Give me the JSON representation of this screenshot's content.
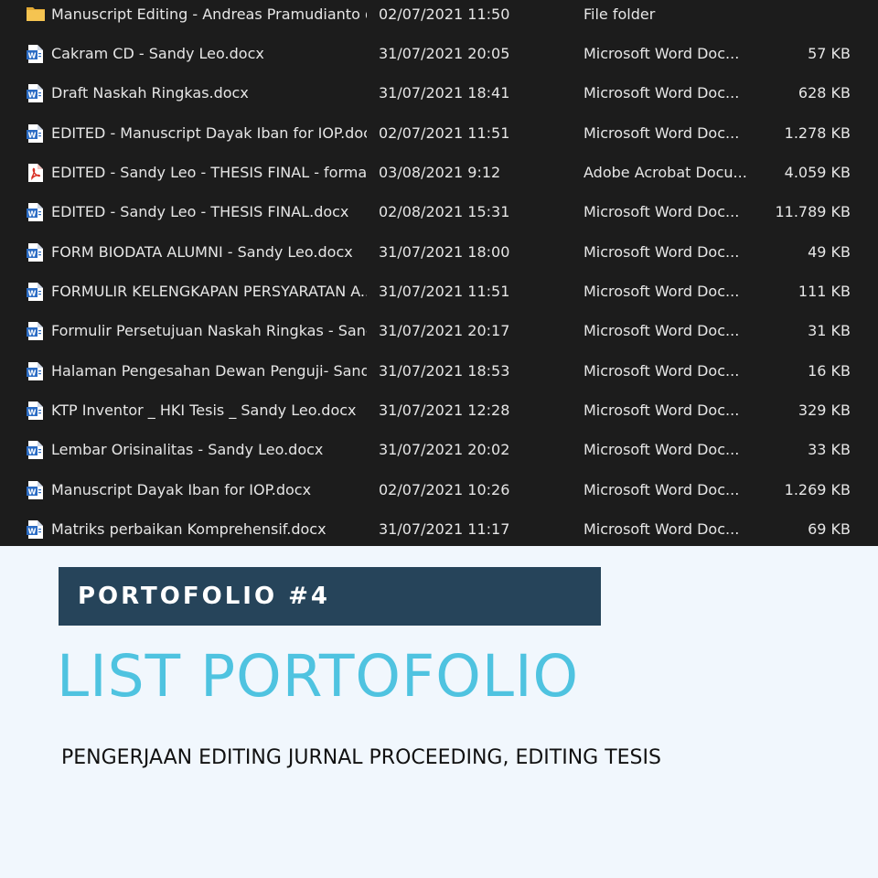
{
  "file_list": [
    {
      "icon": "folder-icon",
      "name": "Manuscript Editing - Andreas Pramudianto d...",
      "date": "02/07/2021 11:50",
      "type": "File folder",
      "size": ""
    },
    {
      "icon": "word-doc-icon",
      "name": "Cakram CD - Sandy Leo.docx",
      "date": "31/07/2021 20:05",
      "type": "Microsoft Word Doc...",
      "size": "57 KB"
    },
    {
      "icon": "word-doc-icon",
      "name": "Draft Naskah Ringkas.docx",
      "date": "31/07/2021 18:41",
      "type": "Microsoft Word Doc...",
      "size": "628 KB"
    },
    {
      "icon": "word-doc-icon",
      "name": "EDITED - Manuscript Dayak Iban for IOP.docx",
      "date": "02/07/2021 11:51",
      "type": "Microsoft Word Doc...",
      "size": "1.278 KB"
    },
    {
      "icon": "pdf-icon",
      "name": "EDITED - Sandy Leo - THESIS FINAL - format...",
      "date": "03/08/2021 9:12",
      "type": "Adobe Acrobat Docu...",
      "size": "4.059 KB"
    },
    {
      "icon": "word-doc-icon",
      "name": "EDITED - Sandy Leo - THESIS FINAL.docx",
      "date": "02/08/2021 15:31",
      "type": "Microsoft Word Doc...",
      "size": "11.789 KB"
    },
    {
      "icon": "word-doc-icon",
      "name": "FORM BIODATA ALUMNI - Sandy Leo.docx",
      "date": "31/07/2021 18:00",
      "type": "Microsoft Word Doc...",
      "size": "49 KB"
    },
    {
      "icon": "word-doc-icon",
      "name": "FORMULIR KELENGKAPAN PERSYARATAN A...",
      "date": "31/07/2021 11:51",
      "type": "Microsoft Word Doc...",
      "size": "111 KB"
    },
    {
      "icon": "word-doc-icon",
      "name": "Formulir Persetujuan Naskah Ringkas - Sand...",
      "date": "31/07/2021 20:17",
      "type": "Microsoft Word Doc...",
      "size": "31 KB"
    },
    {
      "icon": "word-doc-icon",
      "name": "Halaman Pengesahan Dewan Penguji- Sandy...",
      "date": "31/07/2021 18:53",
      "type": "Microsoft Word Doc...",
      "size": "16 KB"
    },
    {
      "icon": "word-doc-icon",
      "name": "KTP Inventor _ HKI Tesis _ Sandy Leo.docx",
      "date": "31/07/2021 12:28",
      "type": "Microsoft Word Doc...",
      "size": "329 KB"
    },
    {
      "icon": "word-doc-icon",
      "name": "Lembar Orisinalitas - Sandy Leo.docx",
      "date": "31/07/2021 20:02",
      "type": "Microsoft Word Doc...",
      "size": "33 KB"
    },
    {
      "icon": "word-doc-icon",
      "name": "Manuscript Dayak Iban for IOP.docx",
      "date": "02/07/2021 10:26",
      "type": "Microsoft Word Doc...",
      "size": "1.269 KB"
    },
    {
      "icon": "word-doc-icon",
      "name": "Matriks perbaikan Komprehensif.docx",
      "date": "31/07/2021 11:17",
      "type": "Microsoft Word Doc...",
      "size": "69 KB"
    }
  ],
  "banner": {
    "label": "PORTOFOLIO #4"
  },
  "headline": "LIST PORTOFOLIO",
  "subtitle": "PENGERJAAN EDITING JURNAL PROCEEDING, EDITING TESIS",
  "colors": {
    "explorer_bg": "#1c1c1c",
    "banner_bg": "#26445a",
    "headline": "#4fc3e0",
    "page_bg": "#f1f7fd",
    "word_icon": "#2b6cc4",
    "pdf_icon": "#d93025",
    "folder_icon": "#f5c451"
  }
}
